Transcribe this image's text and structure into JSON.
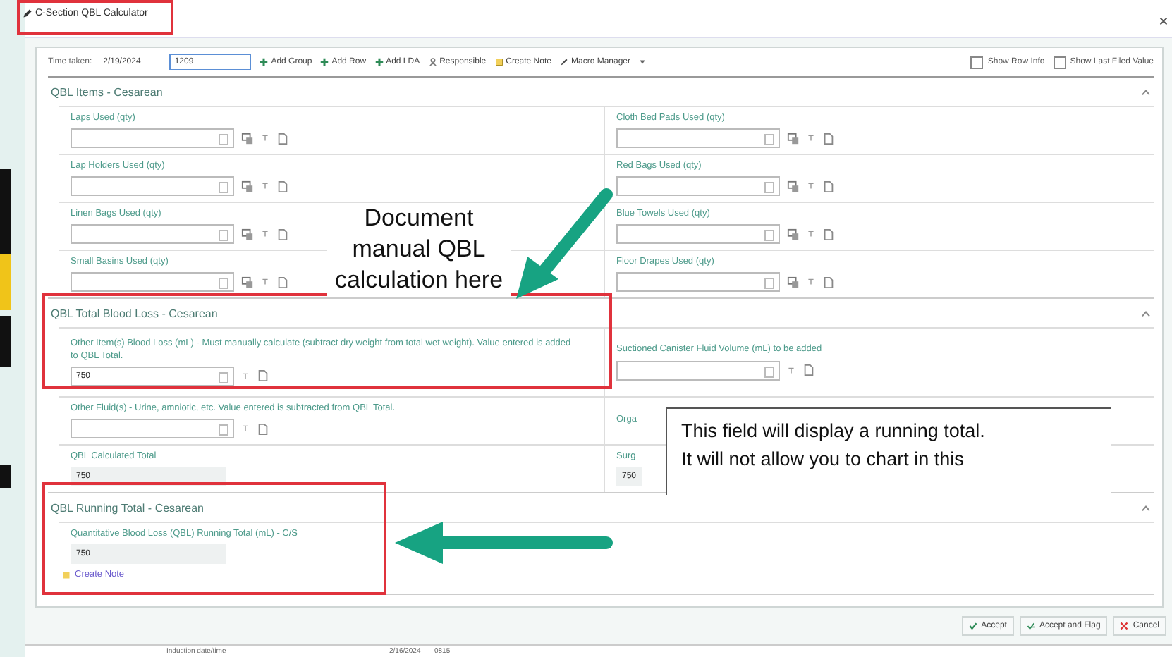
{
  "window": {
    "title": "C-Section QBL Calculator",
    "highlighted": true
  },
  "toolbar": {
    "time_label": "Time taken:",
    "date": "2/19/2024",
    "time": "1209",
    "actions": [
      {
        "kind": "add",
        "label": "Add Group"
      },
      {
        "kind": "add",
        "label": "Add Row"
      },
      {
        "kind": "add",
        "label": "Add LDA"
      },
      {
        "kind": "person",
        "label": "Responsible"
      },
      {
        "kind": "note",
        "label": "Create Note"
      },
      {
        "kind": "macro",
        "label": "Macro Manager"
      }
    ],
    "options": [
      {
        "label": "Show Row Info",
        "checked": false
      },
      {
        "label": "Show Last Filed Value",
        "checked": false
      }
    ]
  },
  "sections": [
    {
      "title": "QBL Items - Cesarean",
      "highlighted": false,
      "rows": [
        [
          {
            "kind": "qty",
            "label": "Laps Used (qty)"
          },
          {
            "kind": "qty",
            "label": "Cloth Bed Pads Used (qty)"
          }
        ],
        [
          {
            "kind": "qty",
            "label": "Lap Holders Used (qty)"
          },
          {
            "kind": "qty",
            "label": "Red Bags Used (qty)"
          }
        ],
        [
          {
            "kind": "qty",
            "label": "Linen Bags Used (qty)"
          },
          {
            "kind": "qty",
            "label": "Blue Towels Used (qty)"
          }
        ],
        [
          {
            "kind": "qty",
            "label": "Small Basins Used (qty)"
          },
          {
            "kind": "qty",
            "label": "Floor Drapes Used (qty)"
          }
        ]
      ]
    },
    {
      "title": "QBL Total Blood Loss - Cesarean",
      "highlighted": true,
      "rows": [
        [
          {
            "kind": "volume",
            "label": "Other Item(s) Blood Loss (mL) - Must manually calculate (subtract dry weight from total wet weight). Value entered is added to QBL Total.",
            "value": "750"
          },
          {
            "kind": "volume",
            "label": "Suctioned Canister Fluid Volume (mL) to be added"
          }
        ],
        [
          {
            "kind": "volume",
            "label": "Other Fluid(s) - Urine, amniotic, etc. Value entered is subtracted from QBL Total."
          },
          {
            "kind": "label_only",
            "label": "Orga"
          }
        ],
        [
          {
            "kind": "total",
            "label": "QBL Calculated Total",
            "value": "750"
          },
          {
            "kind": "total",
            "label": "Surg",
            "value": "750"
          }
        ]
      ]
    },
    {
      "title": "QBL Running Total - Cesarean",
      "highlighted": true,
      "rows": [
        [
          {
            "kind": "total",
            "label": "Quantitative Blood Loss (QBL) Running Total (mL) - C/S",
            "value": "750"
          }
        ]
      ],
      "link": "Create Note"
    }
  ],
  "footer": {
    "buttons": [
      {
        "kind": "accept",
        "label": "Accept"
      },
      {
        "kind": "flag",
        "label": "Accept and Flag"
      },
      {
        "kind": "cancel",
        "label": "Cancel"
      }
    ]
  },
  "background_row": [
    "Induction date/time",
    "2/16/2024",
    "0815"
  ],
  "annotations": [
    {
      "kind": "note",
      "text": "Document manual QBL calculation here"
    },
    {
      "kind": "arrow"
    },
    {
      "kind": "callout",
      "lines": [
        "This field will display a running total.",
        "It will not allow you to chart in this"
      ]
    },
    {
      "kind": "arrow"
    }
  ]
}
